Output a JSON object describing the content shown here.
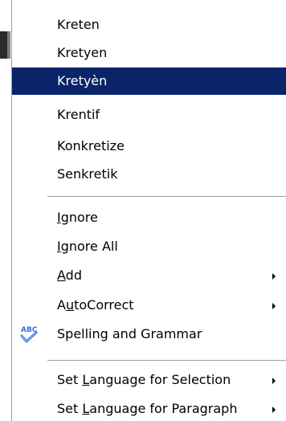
{
  "menu": {
    "suggestions": [
      {
        "label": "Kreten"
      },
      {
        "label": "Kretyen"
      },
      {
        "label": "Kretyèn",
        "selected": true
      },
      {
        "label": "Krentif"
      },
      {
        "label": "Konkretize"
      },
      {
        "label": "Senkretik"
      }
    ],
    "ignore": {
      "pre": "",
      "key": "I",
      "post": "gnore"
    },
    "ignore_all": {
      "pre": "",
      "key": "I",
      "post": "gnore All"
    },
    "add": {
      "pre": "",
      "key": "A",
      "post": "dd"
    },
    "autocorrect": {
      "pre": "A",
      "key": "u",
      "post": "toCorrect"
    },
    "spelling": {
      "label": "Spelling and Grammar",
      "icon": "abc-spellcheck-icon"
    },
    "set_lang_selection": {
      "pre": "Set ",
      "key": "L",
      "post": "anguage for Selection"
    },
    "set_lang_paragraph": {
      "pre": "Set ",
      "key": "L",
      "post": "anguage for Paragraph"
    },
    "colors": {
      "highlight": "#0a246a",
      "text": "#000000",
      "icon_blue": "#3b6fd8"
    }
  }
}
